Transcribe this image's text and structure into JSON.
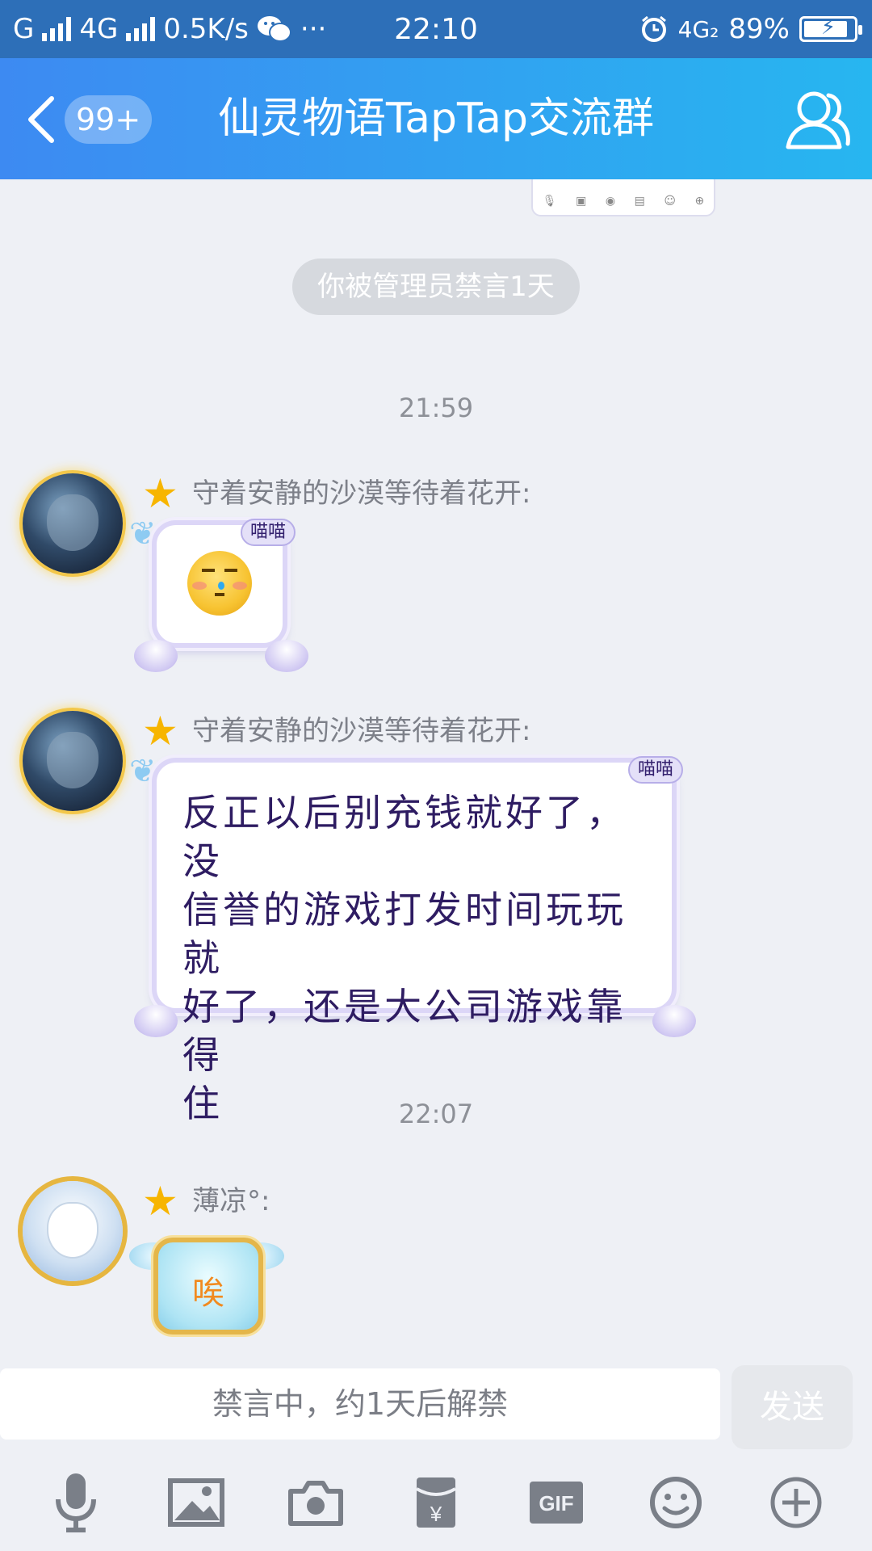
{
  "status_bar": {
    "carrier1": "G",
    "carrier2": "4G",
    "speed": "0.5K/s",
    "more": "···",
    "time": "22:10",
    "network": "4G₂",
    "battery_percent": "89%",
    "battery_level": 0.89
  },
  "header": {
    "back_badge": "99+",
    "title": "仙灵物语TapTap交流群"
  },
  "chat": {
    "system_notice": "你被管理员禁言1天",
    "messages": [
      {
        "time": "21:59",
        "sender": "守着安静的沙漠等待着花开:",
        "bubble_tag": "喵喵"
      },
      {
        "sender": "守着安静的沙漠等待着花开:",
        "bubble_tag": "喵喵",
        "text_lines": [
          "反正以后别充钱就好了，没",
          "信誉的游戏打发时间玩玩就",
          "好了，还是大公司游戏靠得",
          "住"
        ]
      },
      {
        "time": "22:07",
        "sender": "薄凉°:",
        "sticker_text": "唉"
      }
    ]
  },
  "input": {
    "placeholder": "禁言中，约1天后解禁",
    "send_label": "发送"
  },
  "toolbar": {
    "items": [
      "microphone-icon",
      "image-icon",
      "camera-icon",
      "red-packet-icon",
      "gif-icon",
      "emoji-icon",
      "plus-icon"
    ],
    "gif_label": "GIF",
    "red_packet_glyph": "¥"
  },
  "colors": {
    "header_start": "#3d8af2",
    "header_end": "#27b6f0",
    "status_bar": "#2d6fb8",
    "background": "#eef0f5"
  }
}
